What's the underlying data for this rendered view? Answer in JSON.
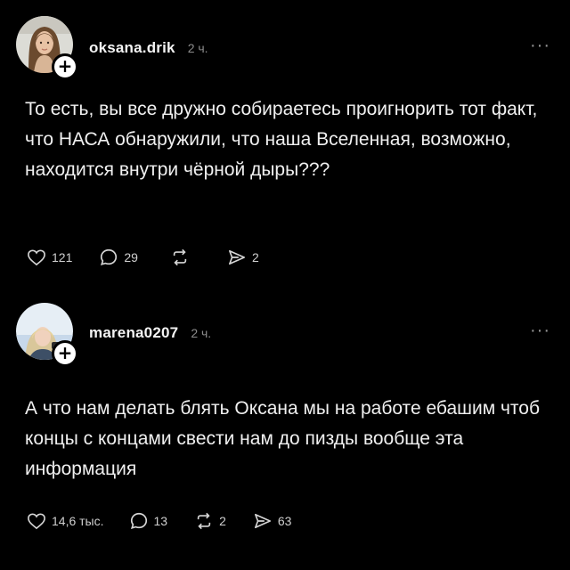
{
  "posts": [
    {
      "username": "oksana.drik",
      "time": "2 ч.",
      "more": "···",
      "text": "То есть, вы все дружно собираетесь проигнорить тот факт, что НАСА обнаружили, что наша Вселенная, возможно, находится внутри чёрной дыры???",
      "likes": "121",
      "comments": "29",
      "reposts": "",
      "shares": "2",
      "avatar_icon": "avatar-woman-long-hair"
    },
    {
      "username": "marena0207",
      "time": "2 ч.",
      "more": "···",
      "text": "А что нам делать блять  Оксана мы на работе ебашим чтоб концы с концами свести нам до пизды вообще эта информация",
      "likes": "14,6 тыс.",
      "comments": "13",
      "reposts": "2",
      "shares": "63",
      "avatar_icon": "avatar-woman-blonde"
    }
  ],
  "follow_badge": "+",
  "colors": {
    "background": "#000000",
    "text": "#f0f0f0",
    "muted": "#8c8c8c"
  }
}
